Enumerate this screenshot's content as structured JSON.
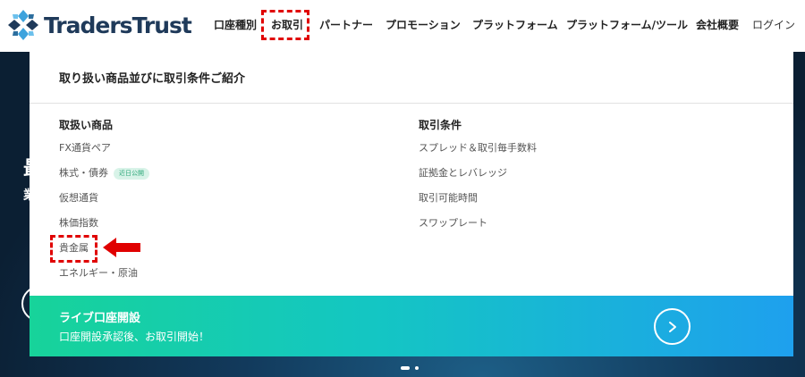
{
  "brand": {
    "name": "TradersTrust"
  },
  "nav": {
    "items": [
      {
        "label": "口座種別"
      },
      {
        "label": "お取引"
      },
      {
        "label": "パートナー"
      },
      {
        "label": "プロモーション"
      },
      {
        "label": "プラットフォーム"
      },
      {
        "label": "プラットフォーム/ツール"
      },
      {
        "label": "会社概要"
      }
    ],
    "login": "ログイン",
    "highlighted": "お取引"
  },
  "hero": {
    "partial_text_1": "最",
    "partial_text_2": "業"
  },
  "dropdown": {
    "title": "取り扱い商品並びに取引条件ご紹介",
    "products": {
      "heading": "取扱い商品",
      "items": [
        {
          "label": "FX通貨ペア"
        },
        {
          "label": "株式・債券",
          "badge": "近日公開"
        },
        {
          "label": "仮想通貨"
        },
        {
          "label": "株価指数"
        },
        {
          "label": "貴金属"
        },
        {
          "label": "エネルギー・原油"
        }
      ]
    },
    "conditions": {
      "heading": "取引条件",
      "items": [
        {
          "label": "スプレッド＆取引毎手数料"
        },
        {
          "label": "証拠金とレバレッジ"
        },
        {
          "label": "取引可能時間"
        },
        {
          "label": "スワップレート"
        }
      ]
    },
    "cta": {
      "title": "ライブ口座開設",
      "subtitle": "口座開設承認後、お取引開始！"
    }
  },
  "colors": {
    "highlight": "#e00000",
    "brand_navy": "#1f3a5a",
    "cta_start": "#17d39a",
    "cta_end": "#1ea0ee"
  }
}
